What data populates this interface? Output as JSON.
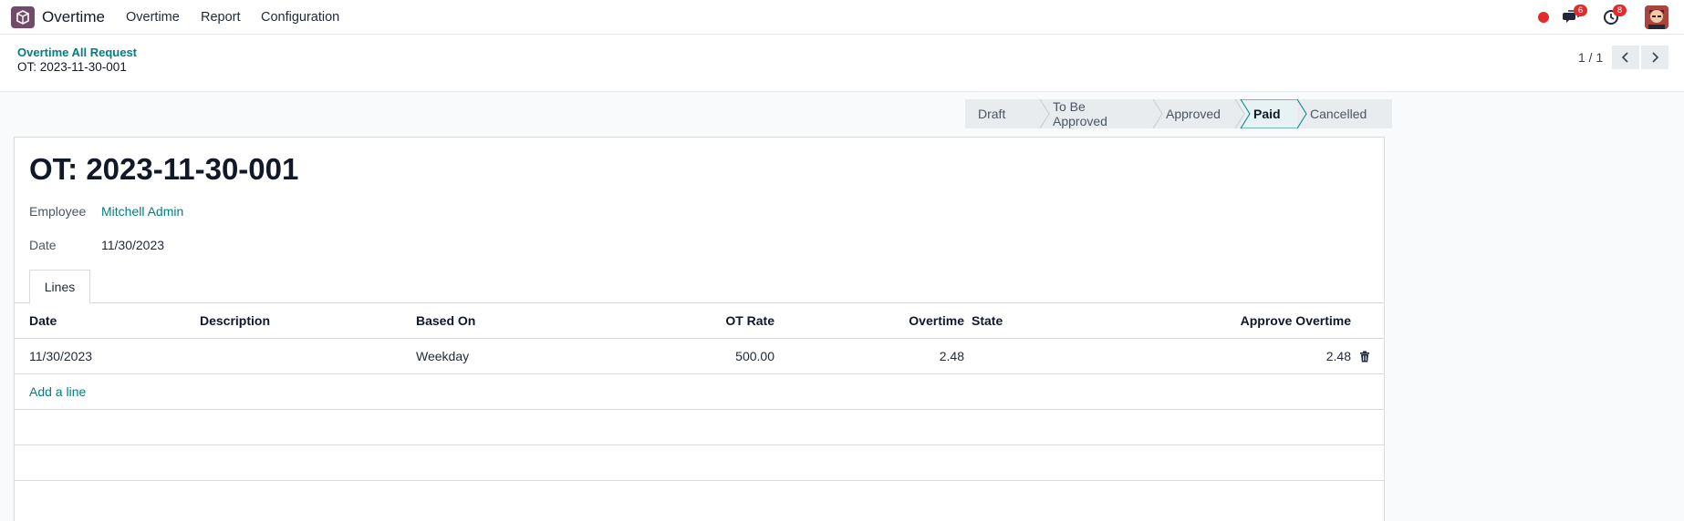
{
  "navbar": {
    "app_name": "Overtime",
    "menu": [
      {
        "label": "Overtime"
      },
      {
        "label": "Report"
      },
      {
        "label": "Configuration"
      }
    ],
    "messages_count": "6",
    "activities_count": "8"
  },
  "breadcrumb": {
    "parent": "Overtime All Request",
    "current": "OT: 2023-11-30-001"
  },
  "pager": {
    "value": "1 / 1"
  },
  "statusbar": {
    "stages": [
      {
        "label": "Draft"
      },
      {
        "label": "To Be Approved"
      },
      {
        "label": "Approved"
      },
      {
        "label": "Paid"
      },
      {
        "label": "Cancelled"
      }
    ],
    "active": "Paid"
  },
  "form": {
    "title": "OT: 2023-11-30-001",
    "employee_label": "Employee",
    "employee_value": "Mitchell Admin",
    "date_label": "Date",
    "date_value": "11/30/2023"
  },
  "tabs": [
    {
      "label": "Lines"
    }
  ],
  "lines": {
    "headers": {
      "date": "Date",
      "description": "Description",
      "based_on": "Based On",
      "ot_rate": "OT Rate",
      "overtime": "Overtime",
      "state": "State",
      "approve_overtime": "Approve Overtime"
    },
    "rows": [
      {
        "date": "11/30/2023",
        "description": "",
        "based_on": "Weekday",
        "ot_rate": "500.00",
        "overtime": "2.48",
        "state": "",
        "approve_overtime": "2.48"
      }
    ],
    "add_line": "Add a line"
  },
  "colors": {
    "brand": "#714b67",
    "link": "#017e84",
    "badge": "#e02c2c"
  }
}
